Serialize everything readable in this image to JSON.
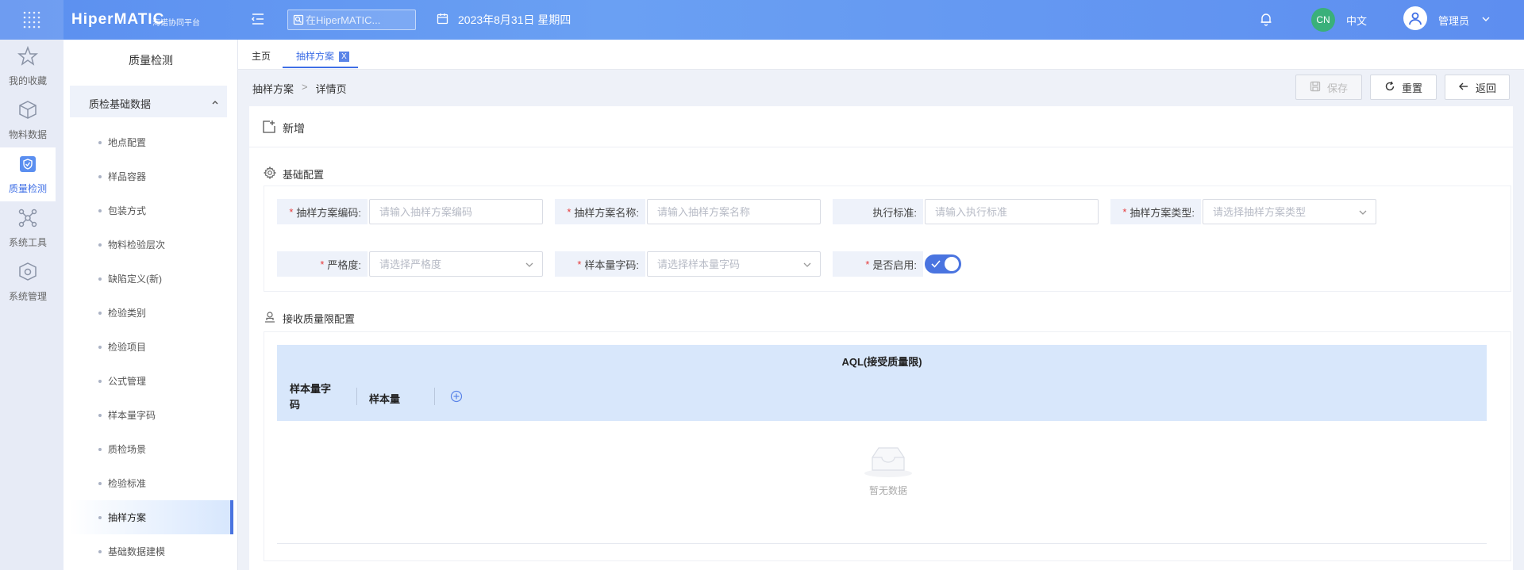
{
  "topbar": {
    "brand": "HiperMATIC",
    "brand_sub": "海诺协同平台",
    "search_placeholder": "在HiperMATIC...",
    "date": "2023年8月31日 星期四",
    "lang_badge": "CN",
    "lang": "中文",
    "user": "管理员"
  },
  "rail": {
    "items": [
      {
        "label": "我的收藏",
        "icon": "star-icon"
      },
      {
        "label": "物料数据",
        "icon": "box-icon"
      },
      {
        "label": "质量检测",
        "icon": "shield-check-icon"
      },
      {
        "label": "系统工具",
        "icon": "network-icon"
      },
      {
        "label": "系统管理",
        "icon": "cube-icon"
      }
    ]
  },
  "sidebar": {
    "title": "质量检测",
    "group": "质检基础数据",
    "items": [
      "地点配置",
      "样品容器",
      "包装方式",
      "物料检验层次",
      "缺陷定义(新)",
      "检验类别",
      "检验项目",
      "公式管理",
      "样本量字码",
      "质检场景",
      "检验标准",
      "抽样方案",
      "基础数据建模"
    ]
  },
  "tabs": {
    "home": "主页",
    "current": "抽样方案",
    "close": "X"
  },
  "breadcrumb": {
    "parent": "抽样方案",
    "sep": ">",
    "current": "详情页"
  },
  "actions": {
    "save": "保存",
    "reset": "重置",
    "back": "返回"
  },
  "card": {
    "title": "新增",
    "basic_section": "基础配置",
    "aql_section": "接收质量限配置"
  },
  "form": {
    "code_label": "抽样方案编码:",
    "code_placeholder": "请输入抽样方案编码",
    "name_label": "抽样方案名称:",
    "name_placeholder": "请输入抽样方案名称",
    "std_label": "执行标准:",
    "std_placeholder": "请输入执行标准",
    "type_label": "抽样方案类型:",
    "type_placeholder": "请选择抽样方案类型",
    "severity_label": "严格度:",
    "severity_placeholder": "请选择严格度",
    "sample_code_label": "样本量字码:",
    "sample_code_placeholder": "请选择样本量字码",
    "enabled_label": "是否启用:",
    "enabled": true
  },
  "table": {
    "group_header": "AQL(接受质量限)",
    "col1_line1": "样本量字",
    "col1_line2": "码",
    "col2": "样本量",
    "empty": "暂无数据"
  },
  "colors": {
    "topbar": "#5b8ff0",
    "accent": "#3f6fe6",
    "required": "#e63b3b",
    "cn_badge": "#3ab07a",
    "table_header": "#d8e7fb"
  }
}
